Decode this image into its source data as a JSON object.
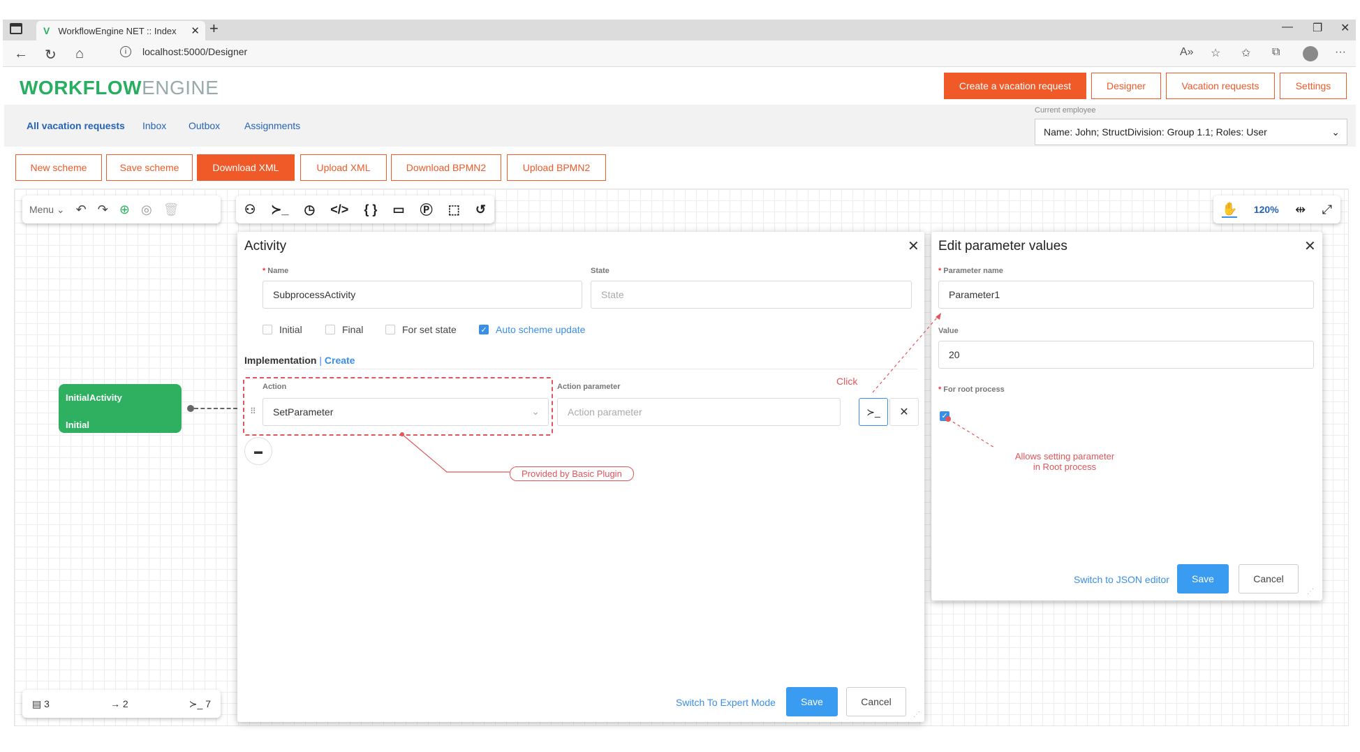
{
  "browser": {
    "tab_title": "WorkflowEngine NET :: Index",
    "tab_logo": "V",
    "url": "localhost:5000/Designer",
    "icons": [
      "tab-switch-icon",
      "close-icon",
      "new-tab-icon",
      "minimize-icon",
      "restore-icon",
      "window-close-icon",
      "back-icon",
      "reload-icon",
      "home-icon",
      "info-icon",
      "read-aloud-icon",
      "favorite-add-icon",
      "favorites-icon",
      "collections-icon",
      "profile-icon",
      "more-icon"
    ]
  },
  "header": {
    "brand_bold": "WORKFLOW",
    "brand_light": "ENGINE",
    "buttons": [
      "Create a vacation request",
      "Designer",
      "Vacation requests",
      "Settings"
    ]
  },
  "subnav": {
    "items": [
      "All vacation requests",
      "Inbox",
      "Outbox",
      "Assignments"
    ],
    "employee_label": "Current employee",
    "employee_value": "Name: John; StructDivision: Group 1.1; Roles: User"
  },
  "toolbar": {
    "buttons": [
      "New scheme",
      "Save scheme",
      "Download XML",
      "Upload XML",
      "Download BPMN2",
      "Upload BPMN2"
    ]
  },
  "designer": {
    "menu_label": "Menu",
    "zoom": "120%",
    "counters": {
      "activities": "3",
      "transitions": "2",
      "commands": "7"
    },
    "node": {
      "name": "InitialActivity",
      "state": "Initial",
      "color": "#2eb060"
    }
  },
  "activity": {
    "title": "Activity",
    "name_label": "Name",
    "name_value": "SubprocessActivity",
    "state_label": "State",
    "state_placeholder": "State",
    "checks": [
      {
        "label": "Initial",
        "checked": false
      },
      {
        "label": "Final",
        "checked": false
      },
      {
        "label": "For set state",
        "checked": false
      },
      {
        "label": "Auto scheme update",
        "checked": true
      }
    ],
    "impl_label": "Implementation",
    "impl_create": "Create",
    "action_label": "Action",
    "action_value": "SetParameter",
    "action_param_label": "Action parameter",
    "action_param_placeholder": "Action parameter",
    "switch_mode": "Switch To Expert Mode",
    "save": "Save",
    "cancel": "Cancel"
  },
  "params": {
    "title": "Edit parameter values",
    "param_name_label": "Parameter name",
    "param_name_value": "Parameter1",
    "value_label": "Value",
    "value_value": "20",
    "root_label": "For root process",
    "root_checked": true,
    "switch_json": "Switch to JSON editor",
    "save": "Save",
    "cancel": "Cancel"
  },
  "annotations": {
    "click": "Click",
    "plugin": "Provided by Basic Plugin",
    "root_note_line1": "Allows setting parameter",
    "root_note_line2": "in Root process",
    "color": "#e0555a"
  }
}
